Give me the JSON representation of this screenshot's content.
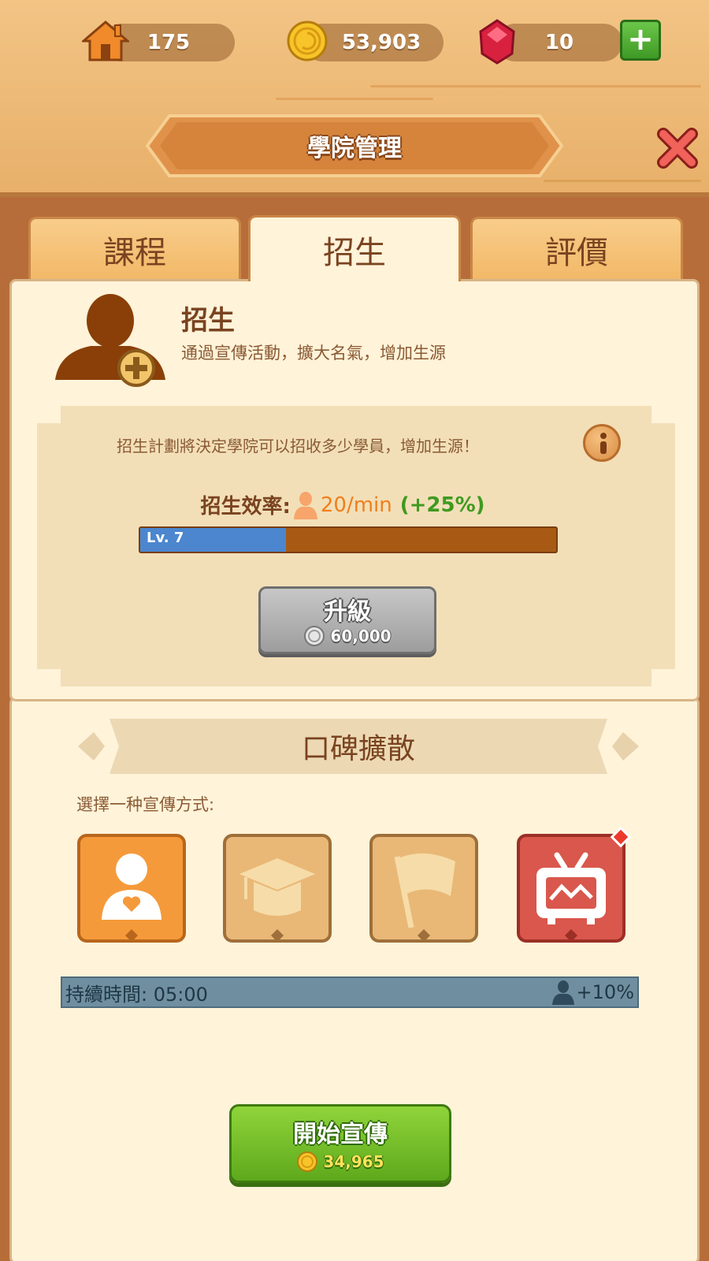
{
  "resources": {
    "houses": "175",
    "coins": "53,903",
    "gems": "10"
  },
  "header": {
    "title": "學院管理"
  },
  "tabs": [
    {
      "label": "課程",
      "active": false
    },
    {
      "label": "招生",
      "active": true
    },
    {
      "label": "評價",
      "active": false
    }
  ],
  "enrollment": {
    "title": "招生",
    "description": "通過宣傳活動，擴大名氣，增加生源",
    "plan_text": "招生計劃將決定學院可以招收多少學員，增加生源！",
    "efficiency_label": "招生效率:",
    "efficiency_rate": "20/min",
    "efficiency_bonus": "(+25%)",
    "level_label": "Lv. 7",
    "level_progress": 0.35,
    "upgrade_label": "升級",
    "upgrade_cost": "60,000"
  },
  "word_of_mouth": {
    "title": "口碑擴散",
    "choose_text": "選擇一种宣傳方式:",
    "options": [
      {
        "icon": "person-heart-icon",
        "selected": true
      },
      {
        "icon": "graduation-cap-icon",
        "selected": false
      },
      {
        "icon": "flag-icon",
        "selected": false
      },
      {
        "icon": "tv-icon",
        "selected": false,
        "badge": true
      }
    ],
    "duration_label": "持續時間: 05:00",
    "duration_bonus": "+10%",
    "start_label": "開始宣傳",
    "start_cost": "34,965"
  },
  "colors": {
    "accent_orange": "#f07e1c",
    "bonus_green": "#3f9a1f",
    "level_blue": "#4b86cf",
    "wood": "#e8b06a"
  }
}
